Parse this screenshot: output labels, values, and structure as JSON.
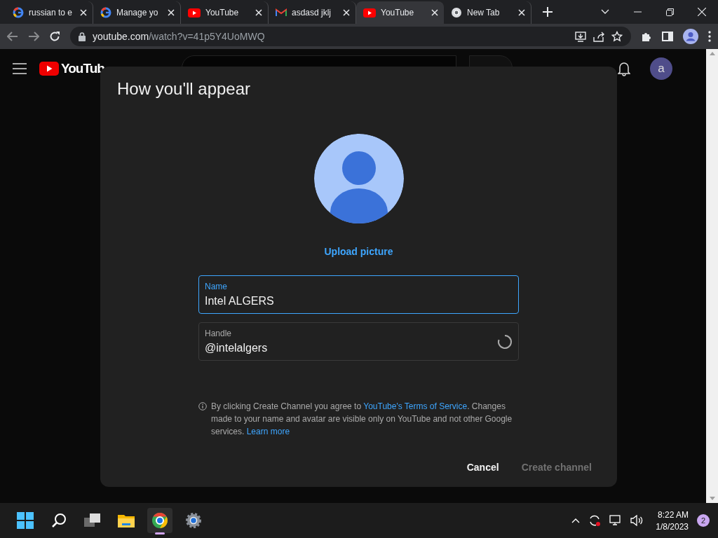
{
  "browser": {
    "tabs": [
      {
        "title": "russian to e",
        "kind": "google",
        "selected": false
      },
      {
        "title": "Manage yo",
        "kind": "google",
        "selected": false
      },
      {
        "title": "YouTube",
        "kind": "youtube",
        "selected": false
      },
      {
        "title": "asdasd jklj",
        "kind": "gmail",
        "selected": false
      },
      {
        "title": "YouTube",
        "kind": "youtube",
        "selected": true
      },
      {
        "title": "New Tab",
        "kind": "chrome",
        "selected": false
      }
    ],
    "address": {
      "host": "youtube.com",
      "path": "/watch?v=41p5Y4UoMWQ"
    }
  },
  "page_header": {
    "logo_text": "YouTub",
    "avatar_letter": "a"
  },
  "dialog": {
    "title": "How you'll appear",
    "upload_label": "Upload picture",
    "fields": [
      {
        "label": "Name",
        "value": "Intel ALGERS",
        "focused": true,
        "loading": false
      },
      {
        "label": "Handle",
        "value": "@intelalgers",
        "focused": false,
        "loading": true
      }
    ],
    "notice": [
      {
        "kind": "text",
        "text": "By clicking Create Channel you agree to "
      },
      {
        "kind": "link",
        "text": "YouTube's Terms of Service"
      },
      {
        "kind": "text",
        "text": ". Changes made to your name and avatar are visible only on YouTube and not other Google services. "
      },
      {
        "kind": "link",
        "text": "Learn more"
      }
    ],
    "buttons": [
      {
        "label": "Cancel",
        "disabled": false
      },
      {
        "label": "Create channel",
        "disabled": true
      }
    ]
  },
  "taskbar": {
    "time": "8:22 AM",
    "date": "1/8/2023",
    "notifications": "2"
  }
}
